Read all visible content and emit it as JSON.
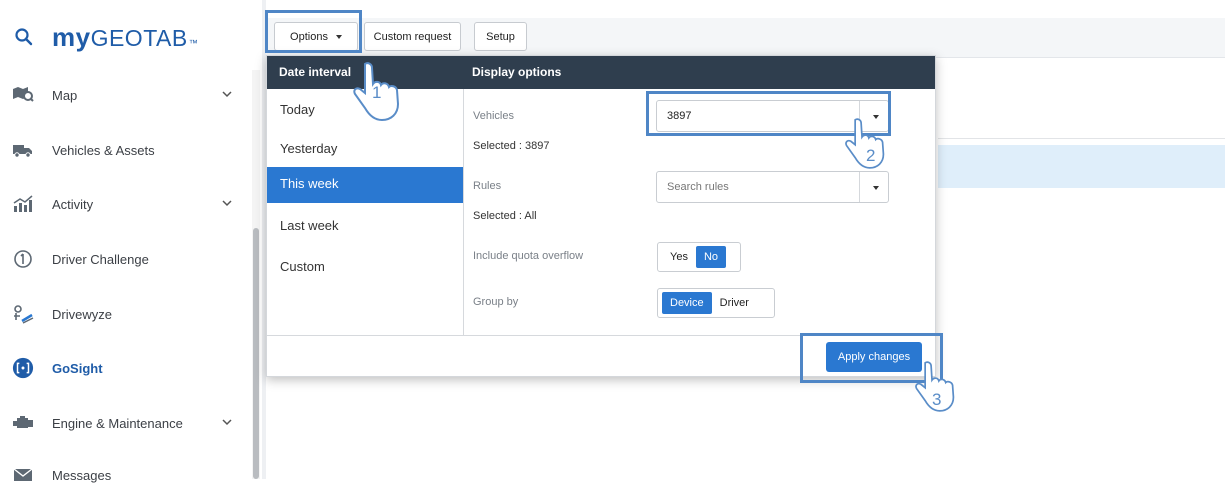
{
  "brand": {
    "prefix": "my",
    "name": "GEOTAB",
    "tm": "™"
  },
  "sidebar": {
    "items": [
      {
        "label": "Map",
        "icon": "map-icon",
        "has_chevron": true
      },
      {
        "label": "Vehicles & Assets",
        "icon": "vehicles-icon",
        "has_chevron": false
      },
      {
        "label": "Activity",
        "icon": "activity-icon",
        "has_chevron": true
      },
      {
        "label": "Driver Challenge",
        "icon": "driver-challenge-icon",
        "has_chevron": false
      },
      {
        "label": "Drivewyze",
        "icon": "drivewyze-icon",
        "has_chevron": false
      },
      {
        "label": "GoSight",
        "icon": "gosight-icon",
        "has_chevron": false,
        "active": true
      },
      {
        "label": "Engine & Maintenance",
        "icon": "engine-icon",
        "has_chevron": true
      },
      {
        "label": "Messages",
        "icon": "messages-icon",
        "has_chevron": false
      }
    ]
  },
  "toolbar": {
    "options_label": "Options",
    "custom_request_label": "Custom request",
    "setup_label": "Setup"
  },
  "panel": {
    "date_header": "Date interval",
    "display_header": "Display options",
    "date_options": [
      "Today",
      "Yesterday",
      "This week",
      "Last week",
      "Custom"
    ],
    "selected_date": "This week",
    "vehicles_label": "Vehicles",
    "vehicles_value": "3897",
    "vehicles_selected": "Selected : 3897",
    "rules_label": "Rules",
    "rules_placeholder": "Search rules",
    "rules_selected": "Selected : All",
    "quota_label": "Include quota overflow",
    "quota_yes": "Yes",
    "quota_no": "No",
    "quota_value": "No",
    "group_label": "Group by",
    "group_device": "Device",
    "group_driver": "Driver",
    "group_value": "Device",
    "apply_label": "Apply changes"
  },
  "step_markers": [
    "1",
    "2",
    "3"
  ],
  "colors": {
    "accent": "#2a78d1",
    "header": "#2f3e4e",
    "highlight": "#4f86c6",
    "brand": "#1f5ca8"
  }
}
